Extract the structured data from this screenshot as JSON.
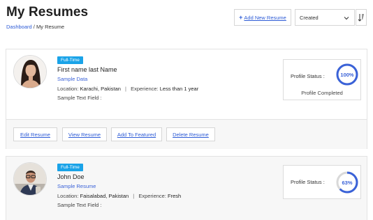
{
  "header": {
    "title": "My Resumes",
    "breadcrumb": {
      "home": "Dashboard",
      "separator": "/",
      "current": "My Resume"
    }
  },
  "toolbar": {
    "add_label": "Add New Resume",
    "sort_value": "Created",
    "sort_icon": "sort-icon"
  },
  "resumes": [
    {
      "badge": "Full-Time",
      "name": "First name  last Name",
      "sample": "Sample Data",
      "location_label": "Location:",
      "location": "Karachi, Pakistan",
      "experience_label": "Experience:",
      "experience": "Less than 1 year",
      "text_field": "Sample Text Field :",
      "status_label": "Profile Status :",
      "percent": "100%",
      "progress": 1.0,
      "status_sub": "Profile Completed",
      "actions": {
        "edit": "Edit Resume",
        "view": "View Resume",
        "featured": "Add To Featured",
        "delete": "Delete Resume"
      }
    },
    {
      "badge": "Full-Time",
      "name": "John  Doe",
      "sample": "Sample Resume",
      "location_label": "Location:",
      "location": "Faisalabad, Pakistan",
      "experience_label": "Experience:",
      "experience": "Fresh",
      "text_field": "Sample Text Field :",
      "status_label": "Profile Status :",
      "percent": "63%",
      "progress": 0.63
    }
  ],
  "colors": {
    "accent": "#3a62d8",
    "badge": "#1aa3e8",
    "ring_track": "#d9d9d9"
  }
}
